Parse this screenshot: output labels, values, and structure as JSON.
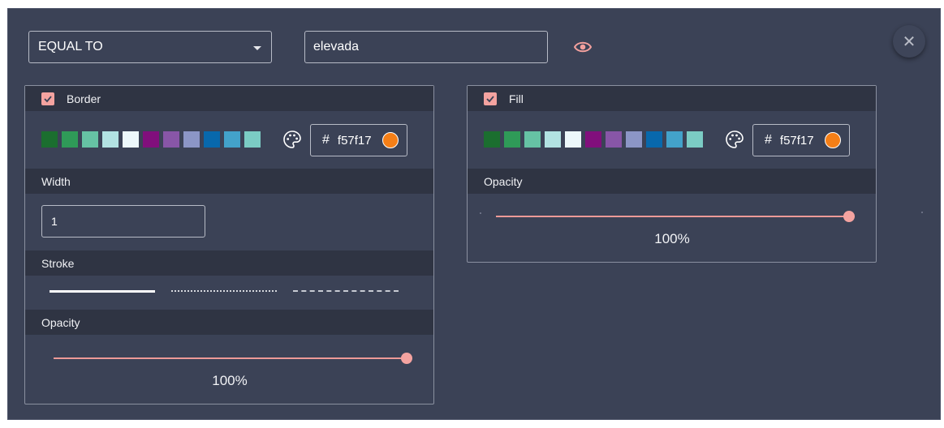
{
  "filter": {
    "operator": "EQUAL TO",
    "value": "elevada"
  },
  "icons": {
    "visibility": "eye-icon",
    "close": "close-icon",
    "palette": "palette-icon",
    "checkbox": "check-icon"
  },
  "border": {
    "label": "Border",
    "checked": true,
    "hash": "#",
    "hex": "f57f17",
    "color": "#f57f17",
    "swatches": [
      "#1b6e2f",
      "#2f9a58",
      "#66c2a4",
      "#b2e2e2",
      "#edf8fb",
      "#810f7c",
      "#8856a7",
      "#8c96c6",
      "#0868ac",
      "#43a2ca",
      "#7bccc4"
    ],
    "width_label": "Width",
    "width_value": "1",
    "stroke_label": "Stroke",
    "strokes": [
      "solid",
      "dotted",
      "dashed"
    ],
    "opacity_label": "Opacity",
    "opacity_value": 1.0,
    "opacity_text": "100%"
  },
  "fill": {
    "label": "Fill",
    "checked": true,
    "hash": "#",
    "hex": "f57f17",
    "color": "#f57f17",
    "swatches": [
      "#1b6e2f",
      "#2f9a58",
      "#66c2a4",
      "#b2e2e2",
      "#edf8fb",
      "#810f7c",
      "#8856a7",
      "#8c96c6",
      "#0868ac",
      "#43a2ca",
      "#7bccc4"
    ],
    "opacity_label": "Opacity",
    "opacity_value": 1.0,
    "opacity_text": "100%"
  },
  "colors": {
    "background": "#3b4256",
    "section_header": "#2f3443",
    "accent": "#f4a3a0"
  }
}
